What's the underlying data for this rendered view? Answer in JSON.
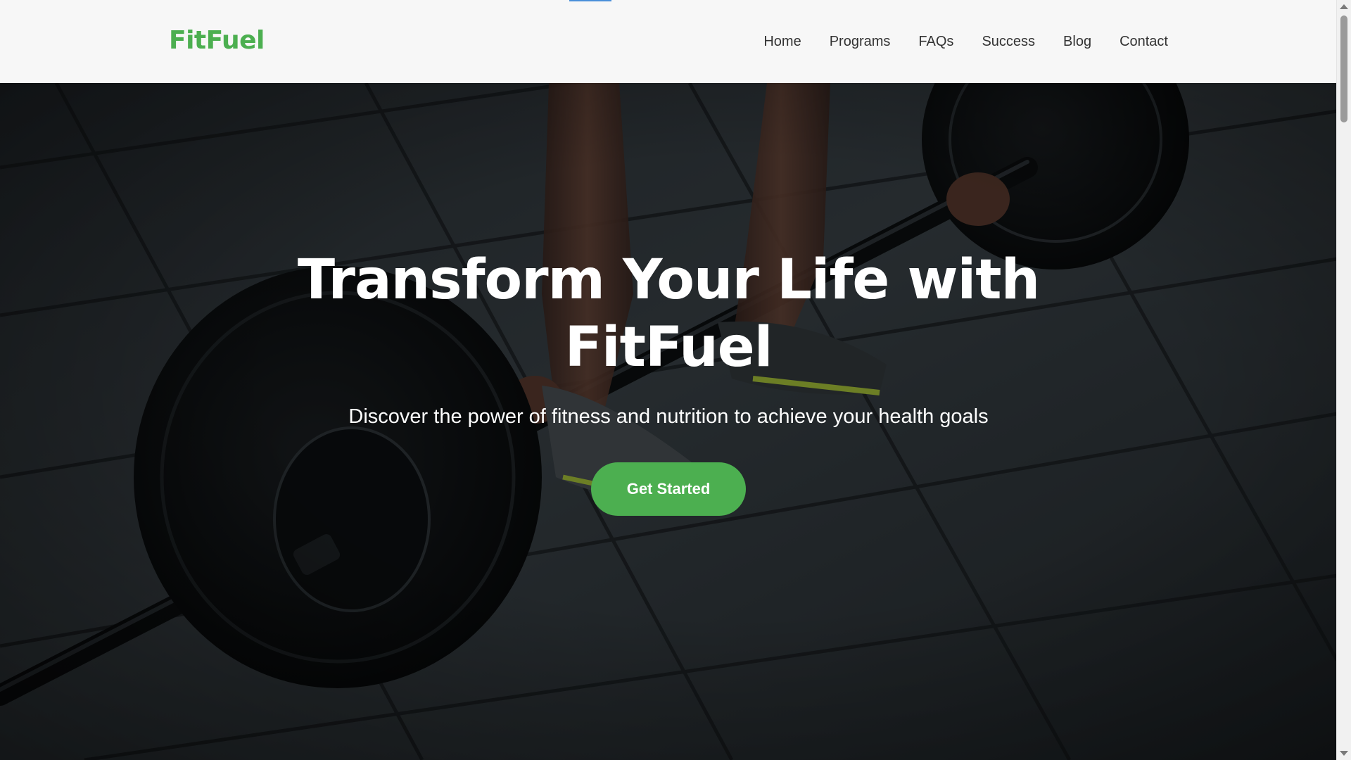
{
  "brand": {
    "name": "FitFuel",
    "color": "#4caf50"
  },
  "nav": {
    "items": [
      {
        "label": "Home"
      },
      {
        "label": "Programs"
      },
      {
        "label": "FAQs"
      },
      {
        "label": "Success"
      },
      {
        "label": "Blog"
      },
      {
        "label": "Contact"
      }
    ]
  },
  "hero": {
    "title": "Transform Your Life with FitFuel",
    "subtitle": "Discover the power of fitness and nutrition to achieve your health goals",
    "cta_label": "Get Started",
    "cta_color": "#4caf50",
    "background_image": "barbell-deadlift-gym-floor"
  },
  "colors": {
    "nav_bg": "#f7f7f7",
    "nav_text": "#333333",
    "hero_text": "#ffffff"
  }
}
